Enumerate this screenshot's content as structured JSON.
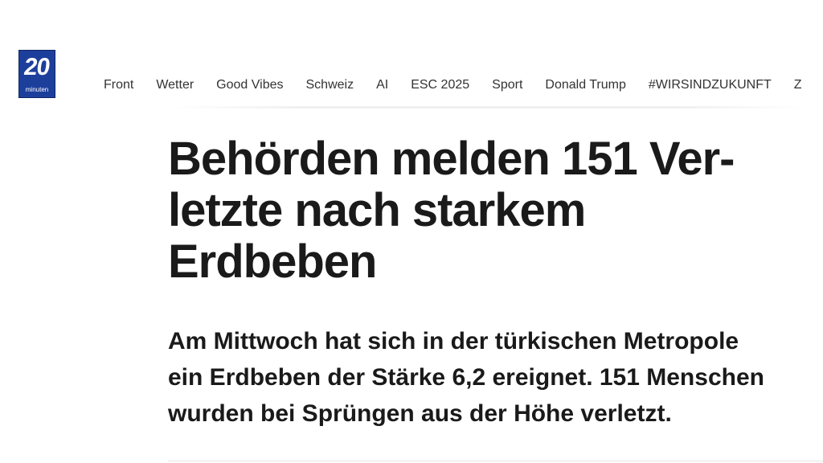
{
  "brand": {
    "logo_number": "20",
    "logo_word": "minuten",
    "color": "#1d3f9c"
  },
  "nav": {
    "items": [
      {
        "label": "Front"
      },
      {
        "label": "Wetter"
      },
      {
        "label": "Good Vibes"
      },
      {
        "label": "Schweiz"
      },
      {
        "label": "AI"
      },
      {
        "label": "ESC 2025"
      },
      {
        "label": "Sport"
      },
      {
        "label": "Donald Trump"
      },
      {
        "label": "#WIRSINDZUKUNFT"
      },
      {
        "label": "Z"
      }
    ]
  },
  "article": {
    "headline_lines": [
      "Behörden melden 151 Ver-",
      "letzte nach starkem",
      "Erdbeben"
    ],
    "lead_lines": [
      "Am Mittwoch hat sich in der türkischen Metropole",
      "ein Erdbeben der Stärke 6,2 ereignet. 151 Menschen",
      "wurden bei Sprüngen aus der Höhe verletzt."
    ]
  }
}
